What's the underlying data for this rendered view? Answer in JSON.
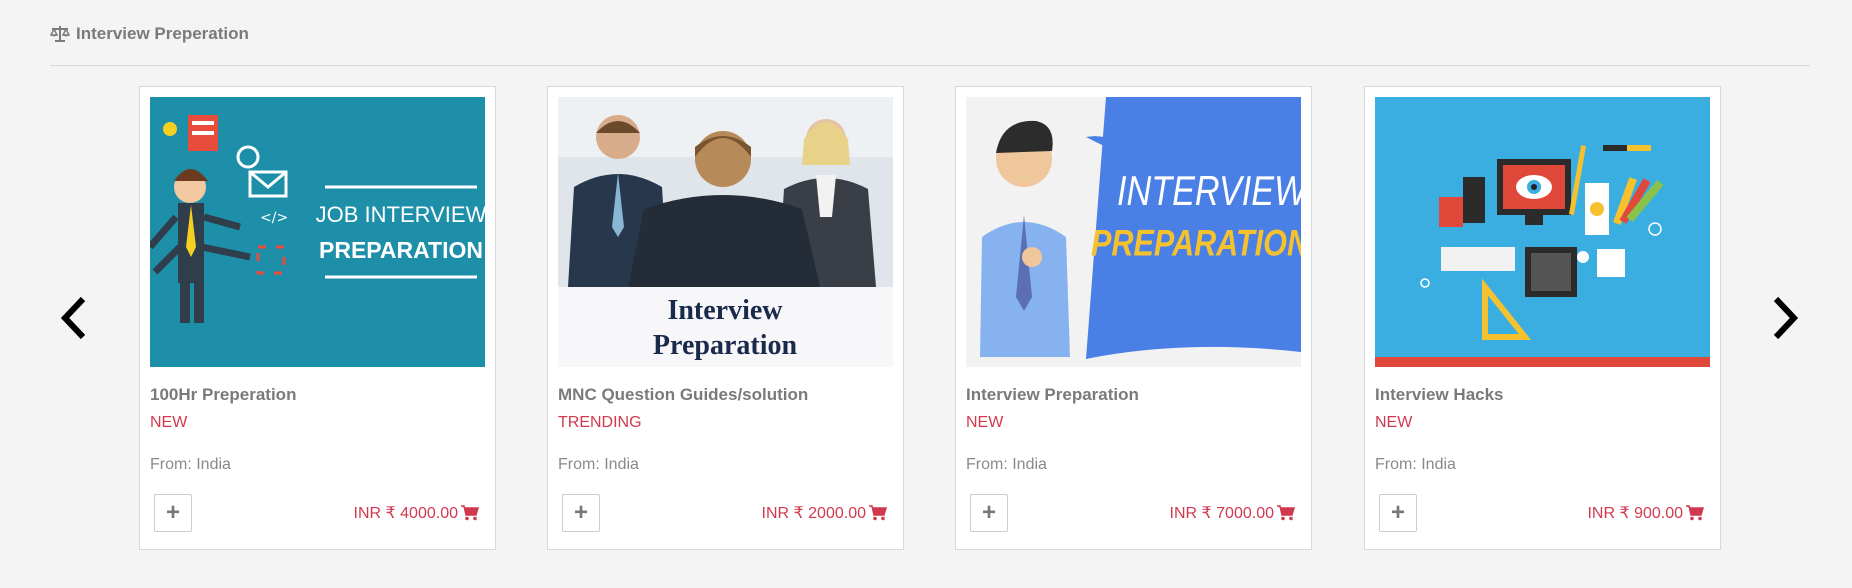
{
  "section": {
    "title": "Interview Preperation",
    "icon": "balance-scale-icon"
  },
  "nav": {
    "prev_icon": "chevron-left-icon",
    "next_icon": "chevron-right-icon"
  },
  "theme": {
    "accent": "#d2394f",
    "muted_text": "#7a7a7a"
  },
  "cards": [
    {
      "title": "100Hr Preperation",
      "badge": "NEW",
      "from": "From: India",
      "price": "INR ₹ 4000.00",
      "add_label": "+",
      "cart_icon": "cart-icon",
      "image": {
        "line1": "JOB INTERVIEW",
        "line2": "PREPARATION"
      }
    },
    {
      "title": "MNC Question Guides/solution",
      "badge": "TRENDING",
      "from": "From: India",
      "price": "INR ₹ 2000.00",
      "add_label": "+",
      "cart_icon": "cart-icon",
      "image": {
        "line1": "Interview",
        "line2": "Preparation"
      }
    },
    {
      "title": "Interview Preparation",
      "badge": "NEW",
      "from": "From: India",
      "price": "INR ₹ 7000.00",
      "add_label": "+",
      "cart_icon": "cart-icon",
      "image": {
        "line1": "INTERVIEW",
        "line2": "PREPARATION"
      }
    },
    {
      "title": "Interview Hacks",
      "badge": "NEW",
      "from": "From: India",
      "price": "INR ₹ 900.00",
      "add_label": "+",
      "cart_icon": "cart-icon",
      "image": {}
    }
  ]
}
